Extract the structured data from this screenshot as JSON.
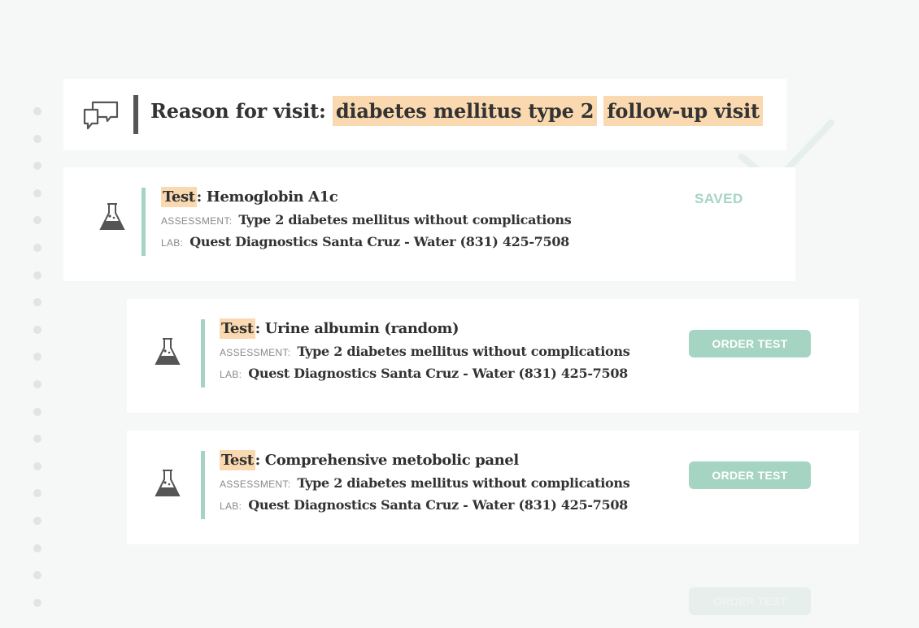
{
  "reason": {
    "label": "Reason for visit",
    "colon": ":",
    "tags": [
      "diabetes mellitus type 2",
      "follow-up visit"
    ]
  },
  "tests": [
    {
      "test_label": "Test",
      "name": "Hemoglobin A1c",
      "assessment_label": "ASSESSMENT:",
      "assessment": "Type 2 diabetes mellitus without complications",
      "lab_label": "LAB:",
      "lab": "Quest Diagnostics Santa Cruz - Water (831) 425-7508",
      "status": "SAVED"
    },
    {
      "test_label": "Test",
      "name": "Urine albumin (random)",
      "assessment_label": "ASSESSMENT:",
      "assessment": "Type 2 diabetes mellitus without complications",
      "lab_label": "LAB:",
      "lab": "Quest Diagnostics Santa Cruz - Water (831) 425-7508",
      "action": "ORDER TEST"
    },
    {
      "test_label": "Test",
      "name": "Comprehensive metobolic panel",
      "assessment_label": "ASSESSMENT:",
      "assessment": "Type 2 diabetes mellitus without complications",
      "lab_label": "LAB:",
      "lab": "Quest Diagnostics Santa Cruz - Water (831) 425-7508",
      "action": "ORDER TEST"
    }
  ],
  "faded_action": "ORDER TEST",
  "colors": {
    "highlight": "#fad9b0",
    "accent_green": "#a6d4c2",
    "background": "#f6f7f7"
  },
  "icons": {
    "reason": "chat-bubbles-icon",
    "test": "flask-icon",
    "saved": "checkmark-icon"
  }
}
